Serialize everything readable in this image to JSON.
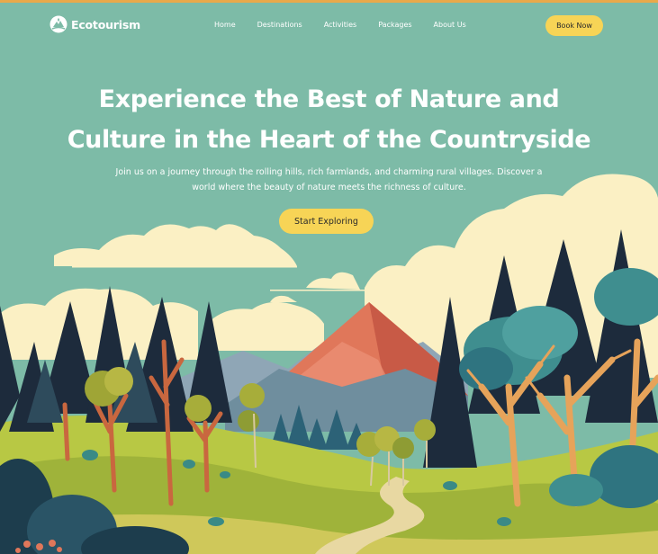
{
  "brand": {
    "name": "Ecotourism",
    "logo_icon": "eco-logo-icon"
  },
  "nav": {
    "items": [
      {
        "label": "Home"
      },
      {
        "label": "Destinations"
      },
      {
        "label": "Activities"
      },
      {
        "label": "Packages"
      },
      {
        "label": "About Us"
      }
    ],
    "cta_label": "Book Now"
  },
  "hero": {
    "title_line1": "Experience the Best of Nature and",
    "title_line2": "Culture in the Heart of the Countryside",
    "subtitle_line1": "Join us on a journey through the rolling hills, rich farmlands, and charming rural villages. Discover a",
    "subtitle_line2": "world where the beauty of nature meets the richness of culture.",
    "cta_label": "Start Exploring"
  },
  "colors": {
    "sky": "#7dbba7",
    "accent": "#f7d456",
    "cloud": "#fbf0c4",
    "mountain": "#e0775a",
    "forest_dark": "#1d2b3c",
    "tree_trunk": "#c9673f",
    "meadow": "#b8c844"
  }
}
